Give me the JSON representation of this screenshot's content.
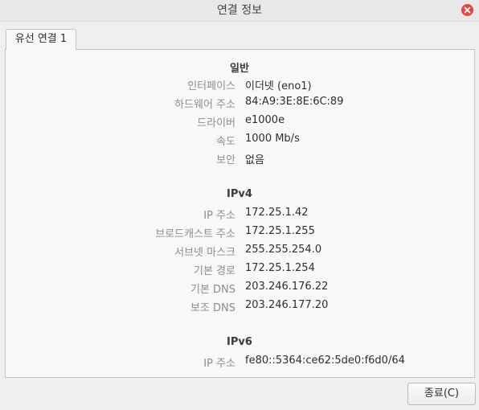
{
  "window": {
    "title": "연결 정보"
  },
  "tab": {
    "label": "유선 연결 1"
  },
  "general": {
    "heading": "일반",
    "rows": [
      {
        "label": "인터페이스",
        "value": "이더넷 (eno1)"
      },
      {
        "label": "하드웨어 주소",
        "value": "84:A9:3E:8E:6C:89"
      },
      {
        "label": "드라이버",
        "value": "e1000e"
      },
      {
        "label": "속도",
        "value": "1000 Mb/s"
      },
      {
        "label": "보안",
        "value": "없음"
      }
    ]
  },
  "ipv4": {
    "heading": "IPv4",
    "rows": [
      {
        "label": "IP 주소",
        "value": "172.25.1.42"
      },
      {
        "label": "브로드캐스트 주소",
        "value": "172.25.1.255"
      },
      {
        "label": "서브넷 마스크",
        "value": "255.255.254.0"
      },
      {
        "label": "기본 경로",
        "value": "172.25.1.254"
      },
      {
        "label": "기본 DNS",
        "value": "203.246.176.22"
      },
      {
        "label": "보조 DNS",
        "value": "203.246.177.20"
      }
    ]
  },
  "ipv6": {
    "heading": "IPv6",
    "rows": [
      {
        "label": "IP 주소",
        "value": "fe80::5364:ce62:5de0:f6d0/64"
      }
    ]
  },
  "footer": {
    "close_label": "종료(C)"
  },
  "icons": {
    "titlebar_close": "close-icon"
  },
  "colors": {
    "close_accent": "#e5453a",
    "label_gray": "#8c8c8c"
  }
}
